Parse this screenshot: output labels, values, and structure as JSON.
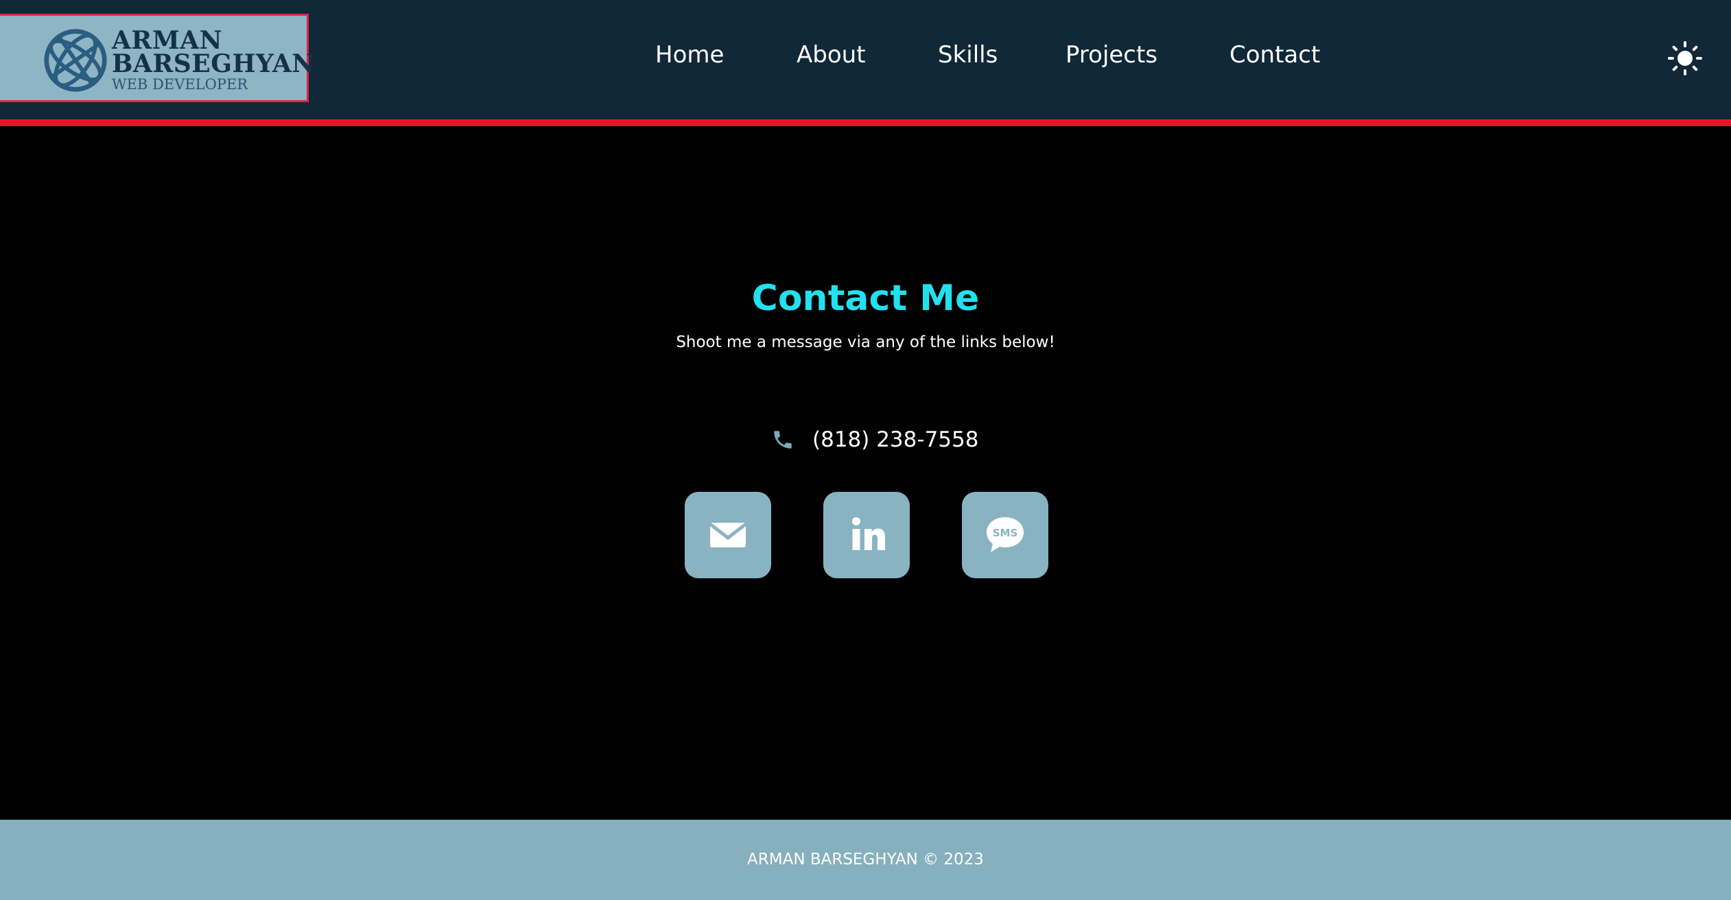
{
  "brand": {
    "name_line1": "ARMAN",
    "name_line2": "BARSEGHYAN",
    "tagline": "WEB DEVELOPER",
    "icon": "globe-icon"
  },
  "nav": {
    "items": [
      {
        "label": "Home"
      },
      {
        "label": "About"
      },
      {
        "label": "Skills"
      },
      {
        "label": "Projects"
      },
      {
        "label": "Contact"
      }
    ],
    "theme_toggle_icon": "sun-icon"
  },
  "contact": {
    "title": "Contact Me",
    "subtitle": "Shoot me a message via any of the links below!",
    "phone": "(818) 238-7558",
    "phone_icon": "phone-icon",
    "links": [
      {
        "icon": "email-icon"
      },
      {
        "icon": "linkedin-icon"
      },
      {
        "icon": "sms-icon",
        "label": "SMS"
      }
    ]
  },
  "footer": {
    "text": "ARMAN BARSEGHYAN © 2023"
  },
  "colors": {
    "header_bg": "#102838",
    "accent_stripe": "#e8112d",
    "title": "#22e0ee",
    "tile_bg": "#8ab3c2",
    "footer_bg": "#86b0bd"
  }
}
